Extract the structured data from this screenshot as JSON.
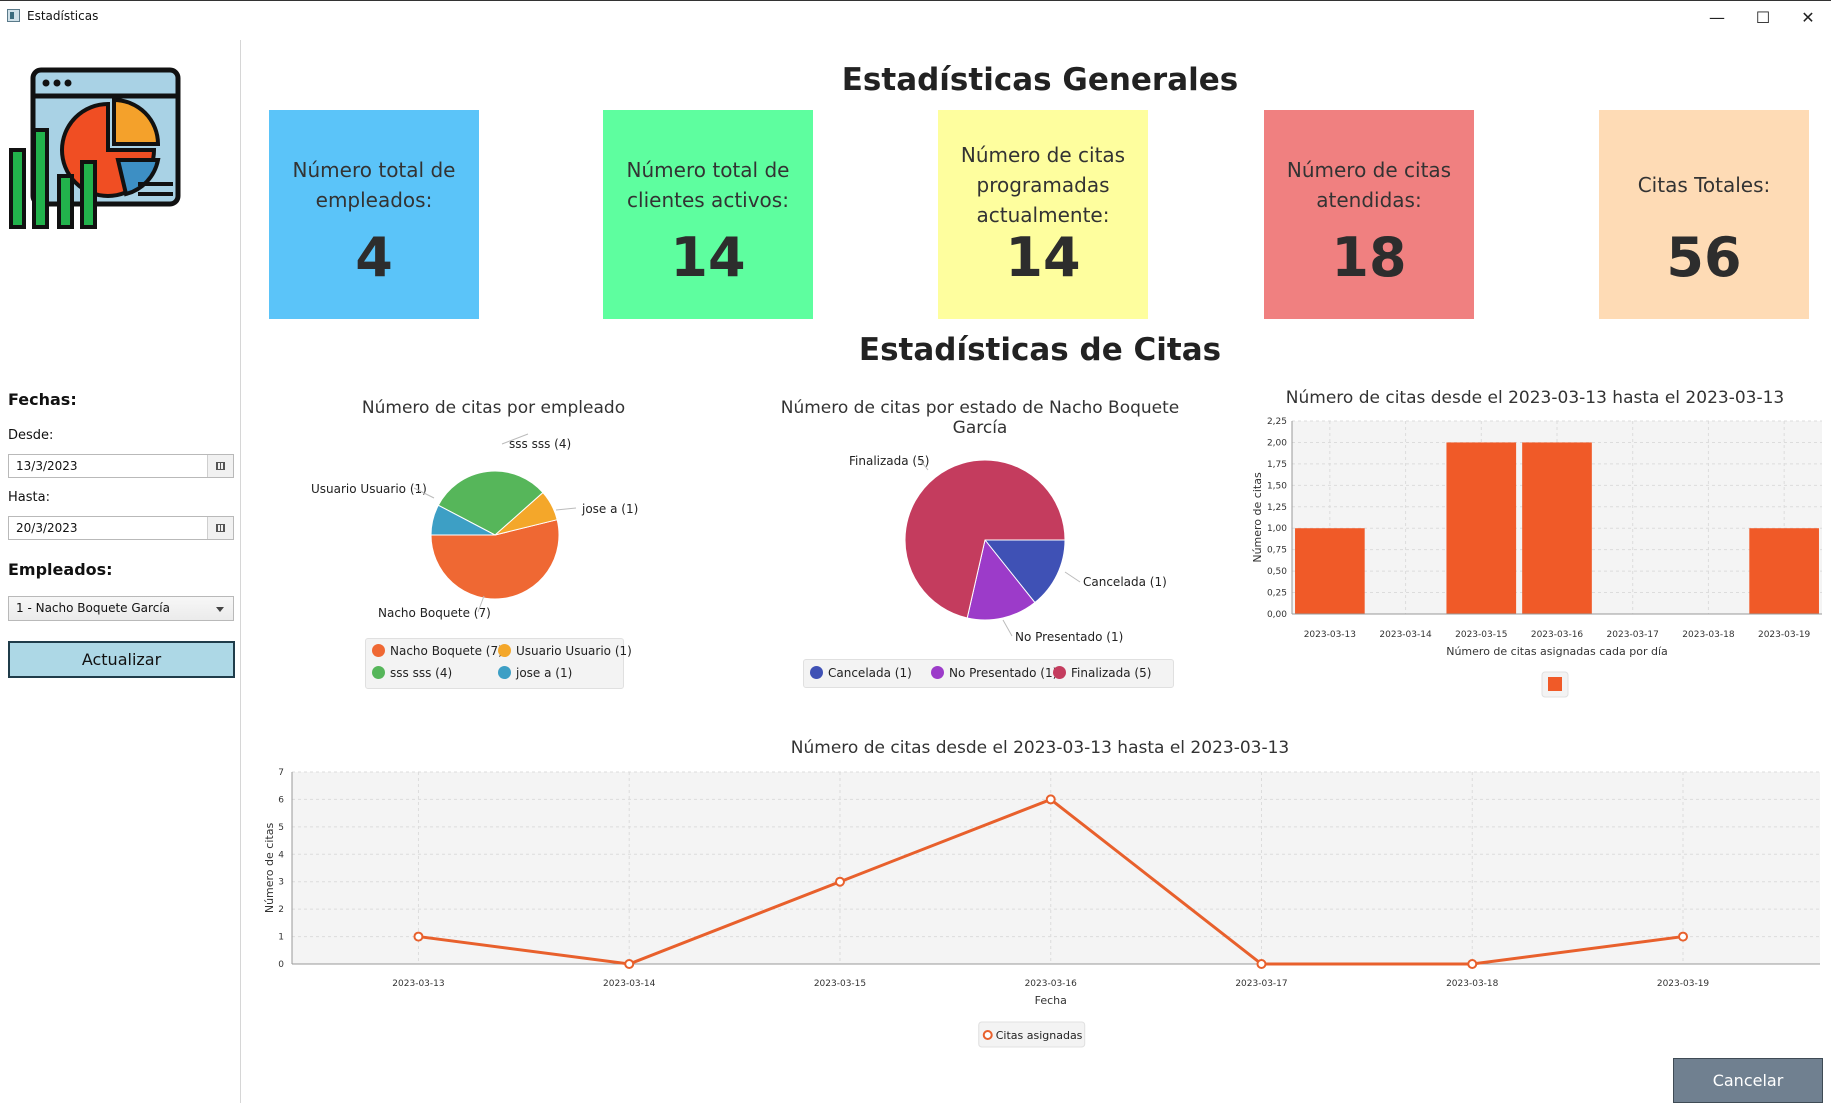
{
  "window": {
    "title": "Estadísticas"
  },
  "sidebar": {
    "dates_heading": "Fechas:",
    "from_label": "Desde:",
    "from_value": "13/3/2023",
    "to_label": "Hasta:",
    "to_value": "20/3/2023",
    "employees_heading": "Empleados:",
    "employee_selected": "1 - Nacho Boquete García",
    "refresh_label": "Actualizar"
  },
  "general": {
    "title": "Estadísticas Generales",
    "cards": [
      {
        "label": "Número total de empleados:",
        "value": "4",
        "color": "#5bc4f9"
      },
      {
        "label": "Número total de clientes activos:",
        "value": "14",
        "color": "#5efe9f"
      },
      {
        "label": "Número de citas programadas actualmente:",
        "value": "14",
        "color": "#fefe9e"
      },
      {
        "label": "Número de citas atendidas:",
        "value": "18",
        "color": "#f08080"
      },
      {
        "label": "Citas Totales:",
        "value": "56",
        "color": "#fedbb5"
      }
    ]
  },
  "citas": {
    "title": "Estadísticas de Citas"
  },
  "chart_data": [
    {
      "type": "pie",
      "title": "Número de citas por empleado",
      "slices": [
        {
          "label": "Nacho Boquete (7)",
          "legend": "Nacho Boquete (7)",
          "value": 7,
          "color": "#ef6833"
        },
        {
          "label": "Usuario Usuario (1)",
          "legend": "Usuario Usuario (1)",
          "value": 1,
          "color": "#f4a72a"
        },
        {
          "label": "sss sss (4)",
          "legend": "sss sss (4)",
          "value": 4,
          "color": "#56b65a"
        },
        {
          "label": "jose a (1)",
          "legend": "jose a (1)",
          "value": 1,
          "color": "#3d9fc5"
        }
      ]
    },
    {
      "type": "pie",
      "title": "Número de citas por estado de Nacho Boquete García",
      "slices": [
        {
          "label": "Cancelada (1)",
          "legend": "Cancelada (1)",
          "value": 1,
          "color": "#3f51b5"
        },
        {
          "label": "No Presentado (1)",
          "legend": "No Presentado (1)",
          "value": 1,
          "color": "#9c3bc9"
        },
        {
          "label": "Finalizada (5)",
          "legend": "Finalizada (5)",
          "value": 5,
          "color": "#c43c5e"
        }
      ]
    },
    {
      "type": "bar",
      "title": "Número de citas desde el 2023-03-13 hasta el 2023-03-13",
      "xlabel": "Número de citas asignadas cada por día",
      "ylabel": "Número de citas",
      "categories": [
        "2023-03-13",
        "2023-03-14",
        "2023-03-15",
        "2023-03-16",
        "2023-03-17",
        "2023-03-18",
        "2023-03-19"
      ],
      "values": [
        1,
        0,
        2,
        2,
        0,
        0,
        1
      ],
      "ylim": [
        0,
        2.25
      ],
      "yticks": [
        "0,00",
        "0,25",
        "0,50",
        "0,75",
        "1,00",
        "1,25",
        "1,50",
        "1,75",
        "2,00",
        "2,25"
      ],
      "color": "#f05a28",
      "grid": true,
      "legend": "bottom"
    },
    {
      "type": "line",
      "title": "Número de citas desde el 2023-03-13 hasta el 2023-03-13",
      "xlabel": "Fecha",
      "ylabel": "Número de citas",
      "x": [
        "2023-03-13",
        "2023-03-14",
        "2023-03-15",
        "2023-03-16",
        "2023-03-17",
        "2023-03-18",
        "2023-03-19"
      ],
      "series": [
        {
          "name": "Citas asignadas",
          "values": [
            1,
            0,
            3,
            6,
            0,
            0,
            1
          ]
        }
      ],
      "ylim": [
        0,
        7
      ],
      "yticks": [
        "0",
        "1",
        "2",
        "3",
        "4",
        "5",
        "6",
        "7"
      ],
      "color": "#e8602c",
      "grid": true,
      "legend": "bottom"
    }
  ],
  "footer": {
    "cancel_label": "Cancelar"
  }
}
